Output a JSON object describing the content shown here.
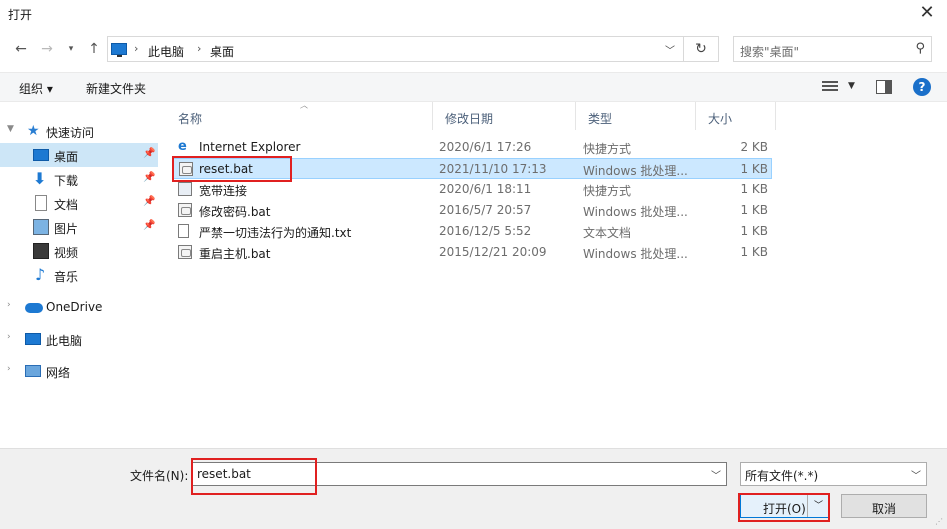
{
  "window": {
    "title": "打开"
  },
  "address": {
    "crumbs": [
      "此电脑",
      "桌面"
    ]
  },
  "search": {
    "placeholder": "搜索\"桌面\""
  },
  "toolbar": {
    "organize": "组织 ▾",
    "new_folder": "新建文件夹",
    "help": "?"
  },
  "sidebar": {
    "items": [
      {
        "label": "快速访问",
        "icon": "star-icon"
      },
      {
        "label": "桌面",
        "icon": "desktop-icon",
        "pinned": true,
        "selected": true
      },
      {
        "label": "下载",
        "icon": "download-icon",
        "pinned": true
      },
      {
        "label": "文档",
        "icon": "document-icon",
        "pinned": true
      },
      {
        "label": "图片",
        "icon": "picture-icon",
        "pinned": true
      },
      {
        "label": "视频",
        "icon": "video-icon"
      },
      {
        "label": "音乐",
        "icon": "music-icon"
      },
      {
        "label": "OneDrive",
        "icon": "cloud-icon"
      },
      {
        "label": "此电脑",
        "icon": "computer-icon"
      },
      {
        "label": "网络",
        "icon": "network-icon"
      }
    ]
  },
  "columns": {
    "name": "名称",
    "date": "修改日期",
    "type": "类型",
    "size": "大小"
  },
  "files": [
    {
      "name": "Internet Explorer",
      "date": "2020/6/1 17:26",
      "type": "快捷方式",
      "size": "2 KB",
      "icon": "ie-icon"
    },
    {
      "name": "reset.bat",
      "date": "2021/11/10 17:13",
      "type": "Windows 批处理...",
      "size": "1 KB",
      "icon": "batch-file-icon",
      "selected": true
    },
    {
      "name": "宽带连接",
      "date": "2020/6/1 18:11",
      "type": "快捷方式",
      "size": "1 KB",
      "icon": "shortcut-icon"
    },
    {
      "name": "修改密码.bat",
      "date": "2016/5/7 20:57",
      "type": "Windows 批处理...",
      "size": "1 KB",
      "icon": "batch-file-icon"
    },
    {
      "name": "严禁一切违法行为的通知.txt",
      "date": "2016/12/5 5:52",
      "type": "文本文档",
      "size": "1 KB",
      "icon": "text-file-icon"
    },
    {
      "name": "重启主机.bat",
      "date": "2015/12/21 20:09",
      "type": "Windows 批处理...",
      "size": "1 KB",
      "icon": "batch-file-icon"
    }
  ],
  "footer": {
    "filename_label": "文件名(N):",
    "filename_value": "reset.bat",
    "filetype_value": "所有文件(*.*)",
    "open_label": "打开(O)",
    "cancel_label": "取消"
  },
  "colors": {
    "highlight": "#e02020",
    "selection": "#cce8ff",
    "accent": "#0078d7"
  }
}
